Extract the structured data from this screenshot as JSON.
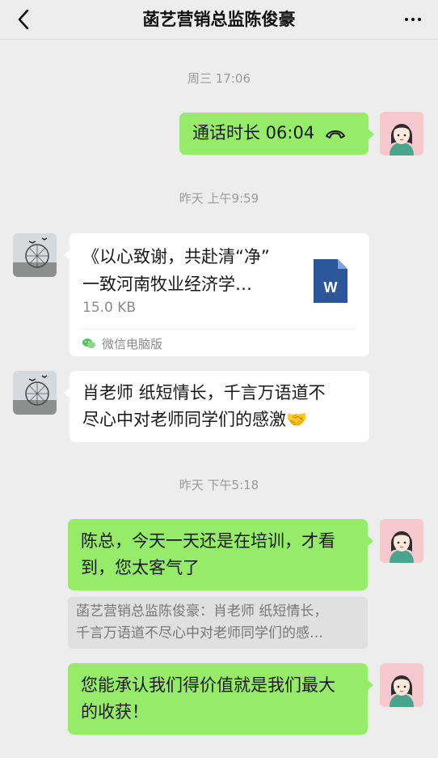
{
  "header": {
    "title": "菡艺营销总监陈俊豪",
    "back_icon": "chevron-left-icon",
    "more_icon": "more-dots-icon"
  },
  "messages": [
    {
      "type": "time",
      "text": "周三 17:06"
    },
    {
      "type": "call",
      "sender": "me",
      "text": "通话时长 06:04",
      "icon": "phone-hangup-icon"
    },
    {
      "type": "time",
      "text": "昨天 上午9:59"
    },
    {
      "type": "file",
      "sender": "other",
      "title_line1": "《以心致谢，共赴清“净”",
      "title_line2": "一致河南牧业经济学…",
      "size": "15.0 KB",
      "source": "微信电脑版",
      "file_icon": "word-document-icon"
    },
    {
      "type": "text",
      "sender": "other",
      "line1": "肖老师 纸短情长，千言万语道不",
      "line2": "尽心中对老师同学们的感激",
      "emoji": "🤝"
    },
    {
      "type": "time",
      "text": "昨天 下午5:18"
    },
    {
      "type": "text",
      "sender": "me",
      "line1": "陈总，今天一天还是在培训，才看",
      "line2": "到，您太客气了"
    },
    {
      "type": "quote",
      "line1": "菡艺营销总监陈俊豪：肖老师 纸短情长，",
      "line2": "千言万语道不尽心中对老师同学们的感…"
    },
    {
      "type": "text",
      "sender": "me",
      "line1": "您能承认我们得价值就是我们最大",
      "line2": "的收获！"
    }
  ],
  "colors": {
    "background": "#ededed",
    "my_bubble": "#95ec69",
    "other_bubble": "#ffffff",
    "word_icon": "#2b579a",
    "timestamp": "#9a9a9a"
  }
}
